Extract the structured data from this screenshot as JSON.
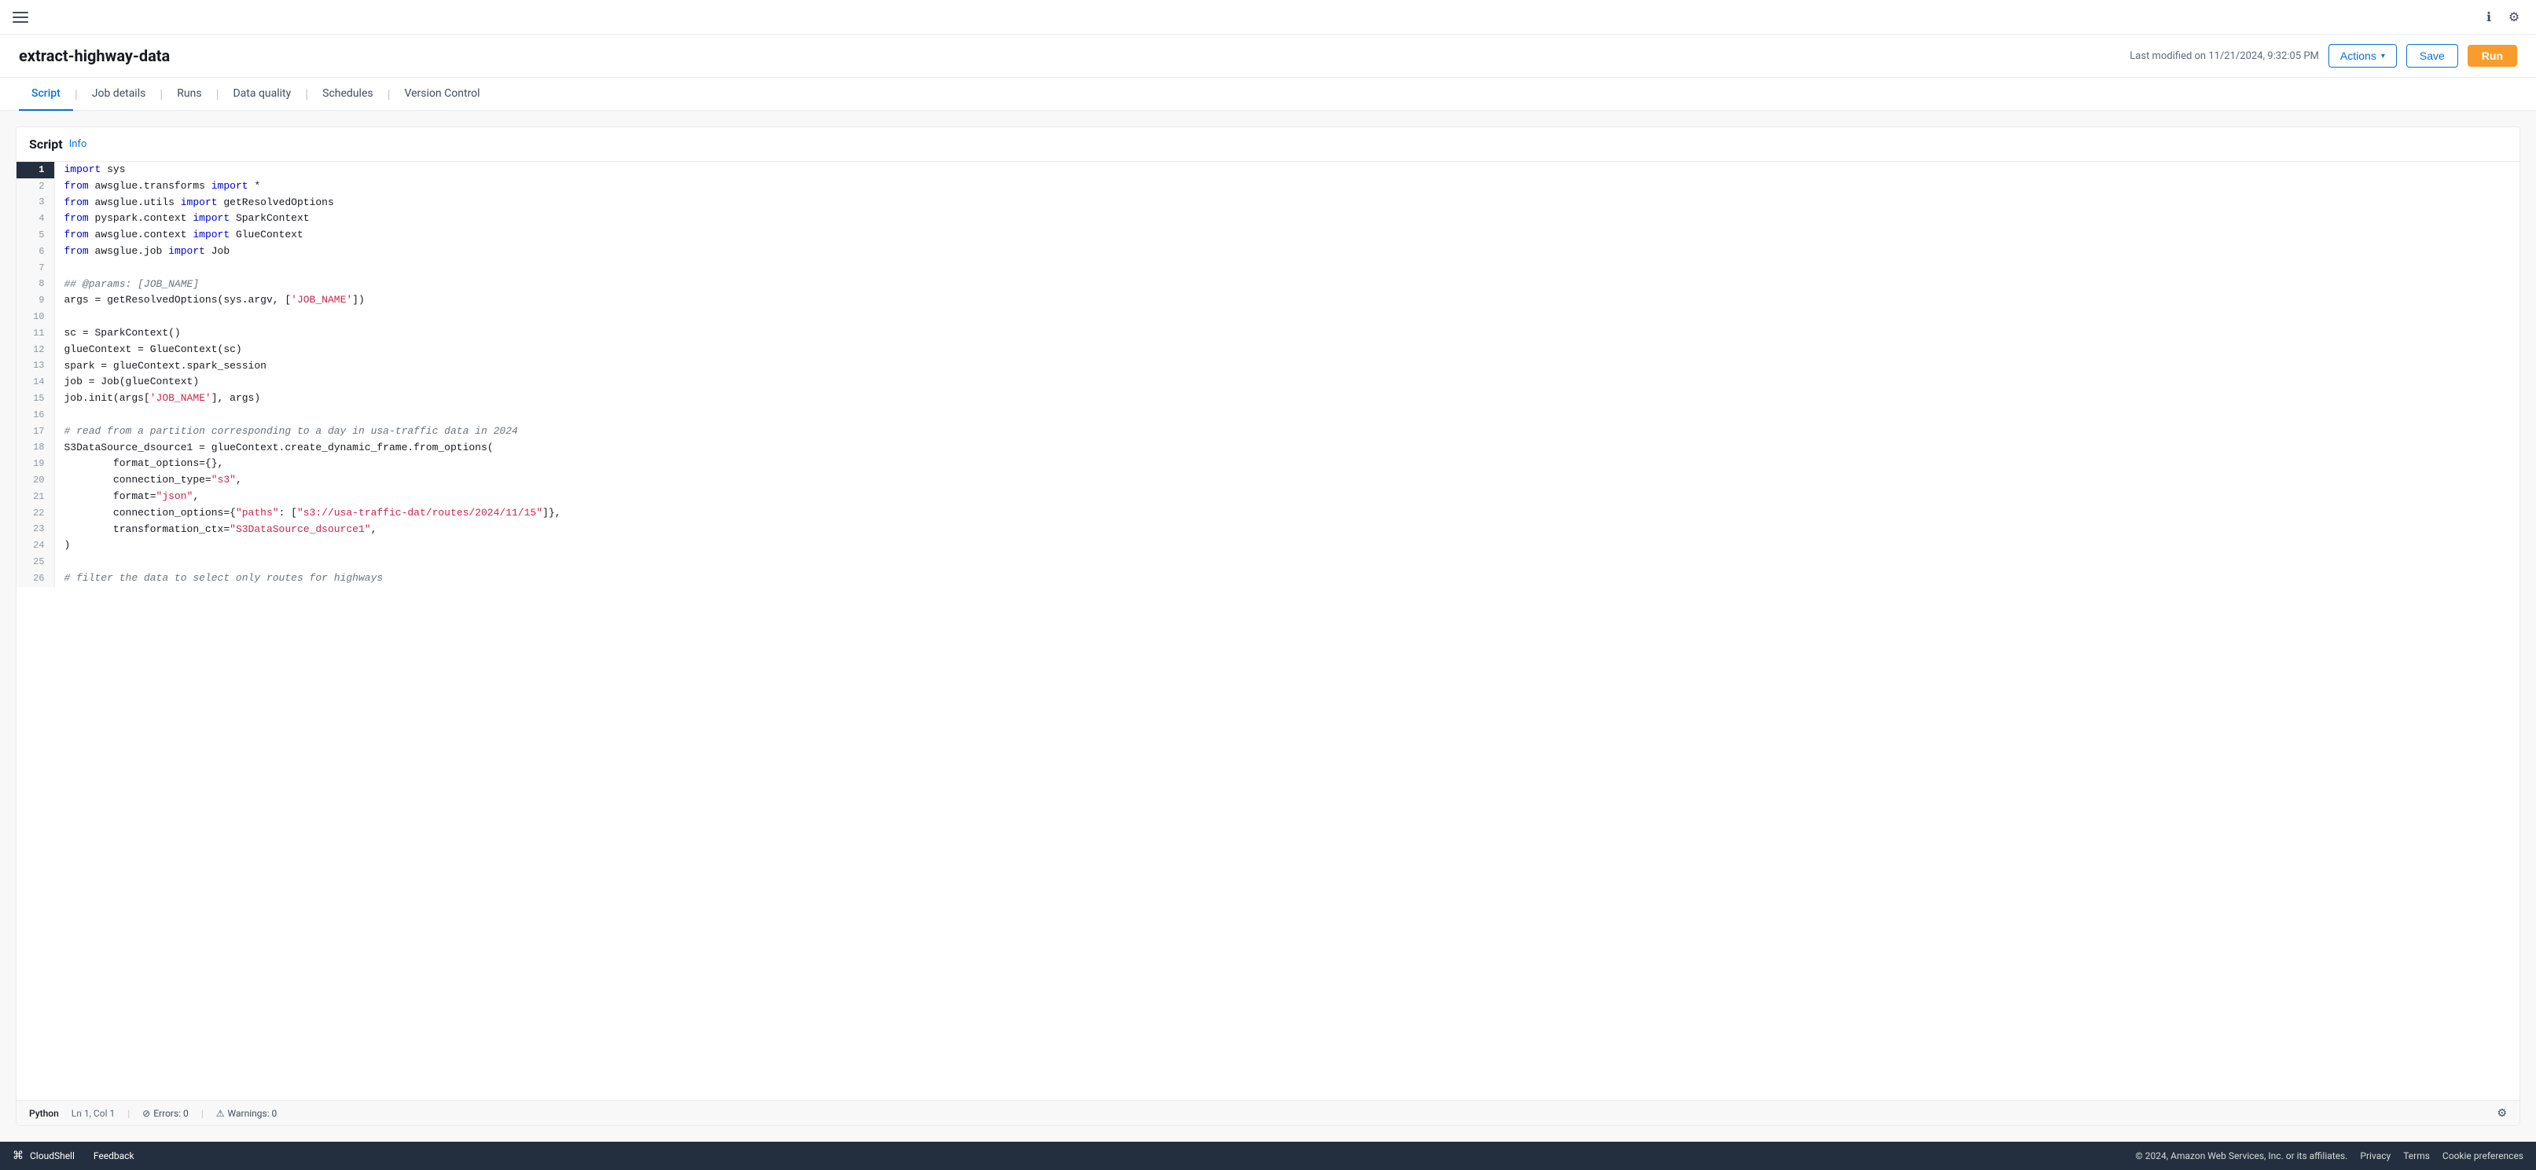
{
  "topbar": {
    "hamburger_label": "menu",
    "info_icon": "ℹ",
    "settings_icon": "⚙"
  },
  "header": {
    "job_title": "extract-highway-data",
    "last_modified": "Last modified on 11/21/2024, 9:32:05 PM",
    "actions_label": "Actions",
    "save_label": "Save",
    "run_label": "Run"
  },
  "tabs": [
    {
      "id": "script",
      "label": "Script",
      "active": true
    },
    {
      "id": "job-details",
      "label": "Job details",
      "active": false
    },
    {
      "id": "runs",
      "label": "Runs",
      "active": false
    },
    {
      "id": "data-quality",
      "label": "Data quality",
      "active": false
    },
    {
      "id": "schedules",
      "label": "Schedules",
      "active": false
    },
    {
      "id": "version-control",
      "label": "Version Control",
      "active": false
    }
  ],
  "script_panel": {
    "title": "Script",
    "info_label": "Info"
  },
  "code_lines": [
    {
      "num": 1,
      "active": true,
      "text": "import sys"
    },
    {
      "num": 2,
      "active": false,
      "text": "from awsglue.transforms import *"
    },
    {
      "num": 3,
      "active": false,
      "text": "from awsglue.utils import getResolvedOptions"
    },
    {
      "num": 4,
      "active": false,
      "text": "from pyspark.context import SparkContext"
    },
    {
      "num": 5,
      "active": false,
      "text": "from awsglue.context import GlueContext"
    },
    {
      "num": 6,
      "active": false,
      "text": "from awsglue.job import Job"
    },
    {
      "num": 7,
      "active": false,
      "text": ""
    },
    {
      "num": 8,
      "active": false,
      "text": "## @params: [JOB_NAME]"
    },
    {
      "num": 9,
      "active": false,
      "text": "args = getResolvedOptions(sys.argv, ['JOB_NAME'])"
    },
    {
      "num": 10,
      "active": false,
      "text": ""
    },
    {
      "num": 11,
      "active": false,
      "text": "sc = SparkContext()"
    },
    {
      "num": 12,
      "active": false,
      "text": "glueContext = GlueContext(sc)"
    },
    {
      "num": 13,
      "active": false,
      "text": "spark = glueContext.spark_session"
    },
    {
      "num": 14,
      "active": false,
      "text": "job = Job(glueContext)"
    },
    {
      "num": 15,
      "active": false,
      "text": "job.init(args['JOB_NAME'], args)"
    },
    {
      "num": 16,
      "active": false,
      "text": ""
    },
    {
      "num": 17,
      "active": false,
      "text": "# read from a partition corresponding to a day in usa-traffic data in 2024"
    },
    {
      "num": 18,
      "active": false,
      "text": "S3DataSource_dsource1 = glueContext.create_dynamic_frame.from_options("
    },
    {
      "num": 19,
      "active": false,
      "text": "        format_options={},"
    },
    {
      "num": 20,
      "active": false,
      "text": "        connection_type=\"s3\","
    },
    {
      "num": 21,
      "active": false,
      "text": "        format=\"json\","
    },
    {
      "num": 22,
      "active": false,
      "text": "        connection_options={\"paths\": [\"s3://usa-traffic-dat/routes/2024/11/15\"]},"
    },
    {
      "num": 23,
      "active": false,
      "text": "        transformation_ctx=\"S3DataSource_dsource1\","
    },
    {
      "num": 24,
      "active": false,
      "text": ")"
    },
    {
      "num": 25,
      "active": false,
      "text": ""
    },
    {
      "num": 26,
      "active": false,
      "text": "# filter the data to select only routes for highways"
    }
  ],
  "status_bar": {
    "language": "Python",
    "position": "Ln 1, Col 1",
    "errors_label": "Errors: 0",
    "warnings_label": "Warnings: 0",
    "error_icon": "⊘",
    "warning_icon": "⚠"
  },
  "footer": {
    "cloudshell_label": "CloudShell",
    "feedback_label": "Feedback",
    "copyright": "© 2024, Amazon Web Services, Inc. or its affiliates.",
    "privacy_label": "Privacy",
    "terms_label": "Terms",
    "cookie_label": "Cookie preferences"
  }
}
